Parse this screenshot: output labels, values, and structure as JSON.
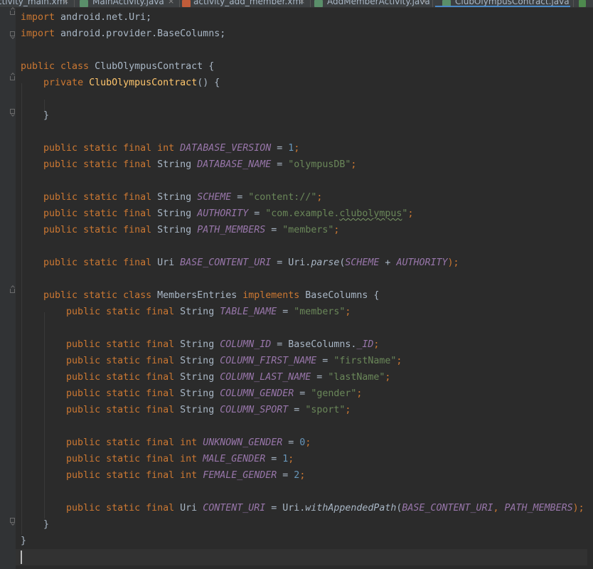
{
  "tabs": [
    {
      "label": "ctivity_main.xml",
      "active": false
    },
    {
      "label": "MainActivity.java",
      "active": false
    },
    {
      "label": "activity_add_member.xml",
      "active": false
    },
    {
      "label": "AddMemberActivity.java",
      "active": false
    },
    {
      "label": "ClubOlympusContract.java",
      "active": true
    }
  ],
  "colors": {
    "background": "#2b2b2b",
    "keyword": "#cc7832",
    "constant": "#9876aa",
    "string": "#6a8759",
    "number": "#6897bb",
    "method_declaration": "#ffc66d",
    "plain": "#a9b7c6",
    "active_tab_underline": "#4a88c7"
  },
  "code": {
    "l1": {
      "k": "import",
      "t": " android.net.Uri;"
    },
    "l2": {
      "k": "import",
      "t": " android.provider.BaseColumns;"
    },
    "l4": {
      "k": "public class",
      "t": " ClubOlympusContract {"
    },
    "l5": {
      "k": "private",
      "f": "ClubOlympusContract",
      "t": "() {"
    },
    "l7": {
      "t": "}"
    },
    "l9": {
      "k": "public static final int",
      "c": "DATABASE_VERSION",
      "e": " = ",
      "n": "1",
      "s": ";"
    },
    "l10": {
      "k": "public static final",
      "ty": " String ",
      "c": "DATABASE_NAME",
      "e": " = ",
      "str": "\"olympusDB\"",
      "s": ";"
    },
    "l12": {
      "k": "public static final",
      "ty": " String ",
      "c": "SCHEME",
      "e": " = ",
      "str": "\"content://\"",
      "s": ";"
    },
    "l13": {
      "k": "public static final",
      "ty": " String ",
      "c": "AUTHORITY",
      "e": " = ",
      "str1": "\"com.example.",
      "str2": "clubolympus",
      "str3": "\"",
      "s": ";"
    },
    "l14": {
      "k": "public static final",
      "ty": " String ",
      "c": "PATH_MEMBERS",
      "e": " = ",
      "str": "\"members\"",
      "s": ";"
    },
    "l16": {
      "k": "public static final",
      "ty": " Uri ",
      "c": "BASE_CONTENT_URI",
      "e": " = Uri.",
      "m": "parse",
      "p1": "(",
      "c2": "SCHEME",
      "op": " + ",
      "c3": "AUTHORITY",
      "s": ");"
    },
    "l18": {
      "k": "public static class",
      "t1": " MembersEntries ",
      "k2": "implements",
      "t2": " BaseColumns {"
    },
    "l19": {
      "k": "public static final",
      "ty": " String ",
      "c": "TABLE_NAME",
      "e": " = ",
      "str": "\"members\"",
      "s": ";"
    },
    "l21": {
      "k": "public static final",
      "ty": " String ",
      "c": "COLUMN_ID",
      "e": " = BaseColumns.",
      "c2": "_ID",
      "s": ";"
    },
    "l22": {
      "k": "public static final",
      "ty": " String ",
      "c": "COLUMN_FIRST_NAME",
      "e": " = ",
      "str": "\"firstName\"",
      "s": ";"
    },
    "l23": {
      "k": "public static final",
      "ty": " String ",
      "c": "COLUMN_LAST_NAME",
      "e": " = ",
      "str": "\"lastName\"",
      "s": ";"
    },
    "l24": {
      "k": "public static final",
      "ty": " String ",
      "c": "COLUMN_GENDER",
      "e": " = ",
      "str": "\"gender\"",
      "s": ";"
    },
    "l25": {
      "k": "public static final",
      "ty": " String ",
      "c": "COLUMN_SPORT",
      "e": " = ",
      "str": "\"sport\"",
      "s": ";"
    },
    "l27": {
      "k": "public static final int",
      "c": "UNKNOWN_GENDER",
      "e": " = ",
      "n": "0",
      "s": ";"
    },
    "l28": {
      "k": "public static final int",
      "c": "MALE_GENDER",
      "e": " = ",
      "n": "1",
      "s": ";"
    },
    "l29": {
      "k": "public static final int",
      "c": "FEMALE_GENDER",
      "e": " = ",
      "n": "2",
      "s": ";"
    },
    "l31": {
      "k": "public static final",
      "ty": " Uri ",
      "c": "CONTENT_URI",
      "e": " = Uri.",
      "m": "withAppendedPath",
      "p1": "(",
      "c2": "BASE_CONTENT_URI",
      "op": ", ",
      "c3": "PATH_MEMBERS",
      "s": ");"
    },
    "l32": {
      "t": "}"
    },
    "l33": {
      "t": "}"
    }
  }
}
